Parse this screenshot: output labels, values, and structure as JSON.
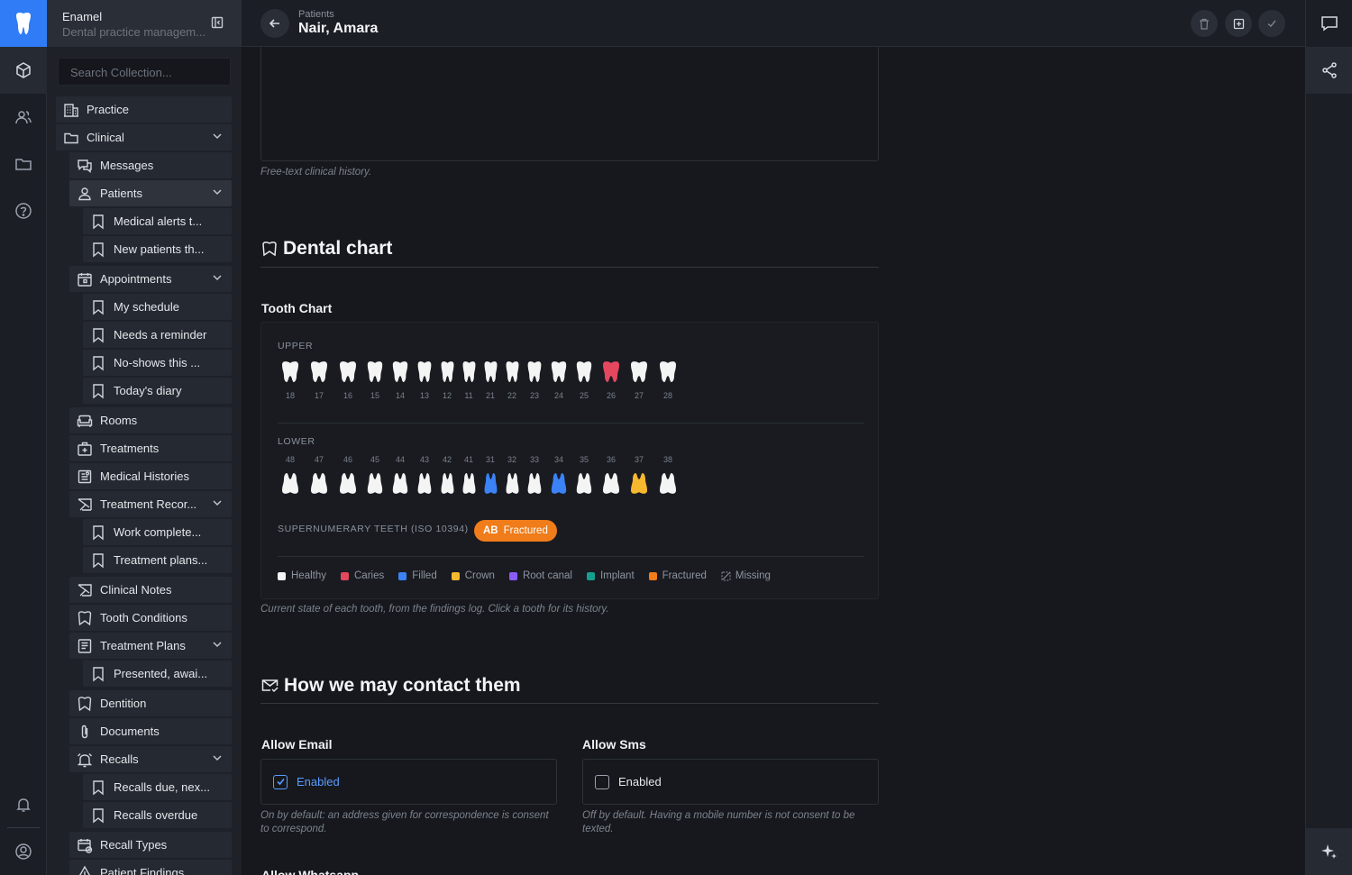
{
  "app": {
    "name": "Enamel",
    "subtitle": "Dental practice managem..."
  },
  "search": {
    "placeholder": "Search Collection..."
  },
  "nav": [
    {
      "label": "Practice",
      "icon": "building-icon",
      "level": 0,
      "chevron": false
    },
    {
      "label": "Clinical",
      "icon": "folder-icon",
      "level": 0,
      "chevron": true
    },
    {
      "label": "Messages",
      "icon": "chat-icon",
      "level": 1,
      "chevron": false
    },
    {
      "label": "Patients",
      "icon": "user-icon",
      "level": 1,
      "chevron": true,
      "selected": true
    },
    {
      "label": "Medical alerts t...",
      "icon": "bookmark-icon",
      "level": 2,
      "chevron": false
    },
    {
      "label": "New patients th...",
      "icon": "bookmark-icon",
      "level": 2,
      "chevron": false
    },
    {
      "label": "Appointments",
      "icon": "calendar-icon",
      "level": 1,
      "chevron": true
    },
    {
      "label": "My schedule",
      "icon": "bookmark-icon",
      "level": 2,
      "chevron": false
    },
    {
      "label": "Needs a reminder",
      "icon": "bookmark-icon",
      "level": 2,
      "chevron": false
    },
    {
      "label": "No-shows this ...",
      "icon": "bookmark-icon",
      "level": 2,
      "chevron": false
    },
    {
      "label": "Today's diary",
      "icon": "bookmark-icon",
      "level": 2,
      "chevron": false
    },
    {
      "label": "Rooms",
      "icon": "sofa-icon",
      "level": 1,
      "chevron": false
    },
    {
      "label": "Treatments",
      "icon": "medical-kit-icon",
      "level": 1,
      "chevron": false
    },
    {
      "label": "Medical Histories",
      "icon": "clipboard-icon",
      "level": 1,
      "chevron": false
    },
    {
      "label": "Treatment Recor...",
      "icon": "signature-icon",
      "level": 1,
      "chevron": true
    },
    {
      "label": "Work complete...",
      "icon": "bookmark-icon",
      "level": 2,
      "chevron": false
    },
    {
      "label": "Treatment plans...",
      "icon": "bookmark-icon",
      "level": 2,
      "chevron": false
    },
    {
      "label": "Clinical Notes",
      "icon": "signature-icon",
      "level": 1,
      "chevron": false
    },
    {
      "label": "Tooth Conditions",
      "icon": "tooth-icon",
      "level": 1,
      "chevron": false
    },
    {
      "label": "Treatment Plans",
      "icon": "list-icon",
      "level": 1,
      "chevron": true
    },
    {
      "label": "Presented, awai...",
      "icon": "bookmark-icon",
      "level": 2,
      "chevron": false
    },
    {
      "label": "Dentition",
      "icon": "tooth-icon",
      "level": 1,
      "chevron": false
    },
    {
      "label": "Documents",
      "icon": "paperclip-icon",
      "level": 1,
      "chevron": false
    },
    {
      "label": "Recalls",
      "icon": "alarm-icon",
      "level": 1,
      "chevron": true
    },
    {
      "label": "Recalls due, nex...",
      "icon": "bookmark-icon",
      "level": 2,
      "chevron": false
    },
    {
      "label": "Recalls overdue",
      "icon": "bookmark-icon",
      "level": 2,
      "chevron": false
    },
    {
      "label": "Recall Types",
      "icon": "calendar-repeat-icon",
      "level": 1,
      "chevron": false
    },
    {
      "label": "Patient Findings",
      "icon": "warning-icon",
      "level": 1,
      "chevron": false
    }
  ],
  "header": {
    "breadcrumb": "Patients",
    "title": "Nair, Amara"
  },
  "history": {
    "help": "Free-text clinical history."
  },
  "dental_chart": {
    "section_title": "Dental chart",
    "field_label": "Tooth Chart",
    "upper_label": "UPPER",
    "lower_label": "LOWER",
    "upper": [
      {
        "n": "18",
        "status": "healthy"
      },
      {
        "n": "17",
        "status": "healthy"
      },
      {
        "n": "16",
        "status": "healthy"
      },
      {
        "n": "15",
        "status": "healthy"
      },
      {
        "n": "14",
        "status": "healthy"
      },
      {
        "n": "13",
        "status": "healthy"
      },
      {
        "n": "12",
        "status": "healthy"
      },
      {
        "n": "11",
        "status": "healthy"
      },
      {
        "n": "21",
        "status": "healthy"
      },
      {
        "n": "22",
        "status": "healthy"
      },
      {
        "n": "23",
        "status": "healthy"
      },
      {
        "n": "24",
        "status": "healthy"
      },
      {
        "n": "25",
        "status": "healthy"
      },
      {
        "n": "26",
        "status": "caries"
      },
      {
        "n": "27",
        "status": "healthy"
      },
      {
        "n": "28",
        "status": "healthy"
      }
    ],
    "lower": [
      {
        "n": "48",
        "status": "healthy"
      },
      {
        "n": "47",
        "status": "healthy"
      },
      {
        "n": "46",
        "status": "healthy"
      },
      {
        "n": "45",
        "status": "healthy"
      },
      {
        "n": "44",
        "status": "healthy"
      },
      {
        "n": "43",
        "status": "healthy"
      },
      {
        "n": "42",
        "status": "healthy"
      },
      {
        "n": "41",
        "status": "healthy"
      },
      {
        "n": "31",
        "status": "filled"
      },
      {
        "n": "32",
        "status": "healthy"
      },
      {
        "n": "33",
        "status": "healthy"
      },
      {
        "n": "34",
        "status": "filled"
      },
      {
        "n": "35",
        "status": "healthy"
      },
      {
        "n": "36",
        "status": "healthy"
      },
      {
        "n": "37",
        "status": "crown"
      },
      {
        "n": "38",
        "status": "healthy"
      }
    ],
    "supernumerary_label": "SUPERNUMERARY TEETH (ISO 10394)",
    "supernumerary_pill": {
      "code": "AB",
      "label": "Fractured"
    },
    "legend": [
      {
        "label": "Healthy",
        "color": "#f4f4f4"
      },
      {
        "label": "Caries",
        "color": "#e5475f"
      },
      {
        "label": "Filled",
        "color": "#3b82f6"
      },
      {
        "label": "Crown",
        "color": "#f5b82e"
      },
      {
        "label": "Root canal",
        "color": "#8b5cf6"
      },
      {
        "label": "Implant",
        "color": "#14a090"
      },
      {
        "label": "Fractured",
        "color": "#f07c1a"
      },
      {
        "label": "Missing",
        "color": "none"
      }
    ],
    "help": "Current state of each tooth, from the findings log. Click a tooth for its history."
  },
  "contact": {
    "section_title": "How we may contact them",
    "email": {
      "label": "Allow Email",
      "value_label": "Enabled",
      "checked": true,
      "help": "On by default: an address given for correspondence is consent to correspond."
    },
    "sms": {
      "label": "Allow Sms",
      "value_label": "Enabled",
      "checked": false,
      "help": "Off by default. Having a mobile number is not consent to be texted."
    },
    "next_label": "Allow Whatsapp"
  },
  "colors": {
    "accent": "#2f7cf6",
    "checkbox_on": "#5a9cff",
    "fractured": "#f07c1a"
  }
}
